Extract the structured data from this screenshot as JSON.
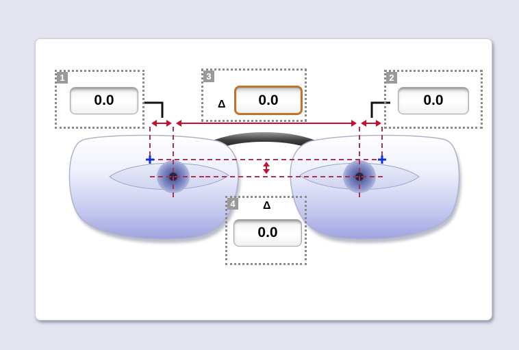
{
  "panel": {
    "right_width": {
      "badge": "1",
      "value": "0.0"
    },
    "left_width": {
      "badge": "2",
      "value": "0.0"
    },
    "horizontal_offset": {
      "badge": "3",
      "delta_symbol": "Δ",
      "value": "0.0"
    },
    "vertical_offset": {
      "badge": "4",
      "delta_symbol": "Δ",
      "value": "0.0"
    }
  },
  "icons": {
    "marker": "plus-marker-icon",
    "arrows": "double-arrow-icon"
  },
  "colors": {
    "background": "#e4e4f0",
    "card": "#ffffff",
    "guide_line": "#c8102e",
    "dashed_guide": "#a8324f",
    "marker": "#1030e0",
    "active_field_border": "#c0742a",
    "group_border": "#8a8a8a"
  }
}
